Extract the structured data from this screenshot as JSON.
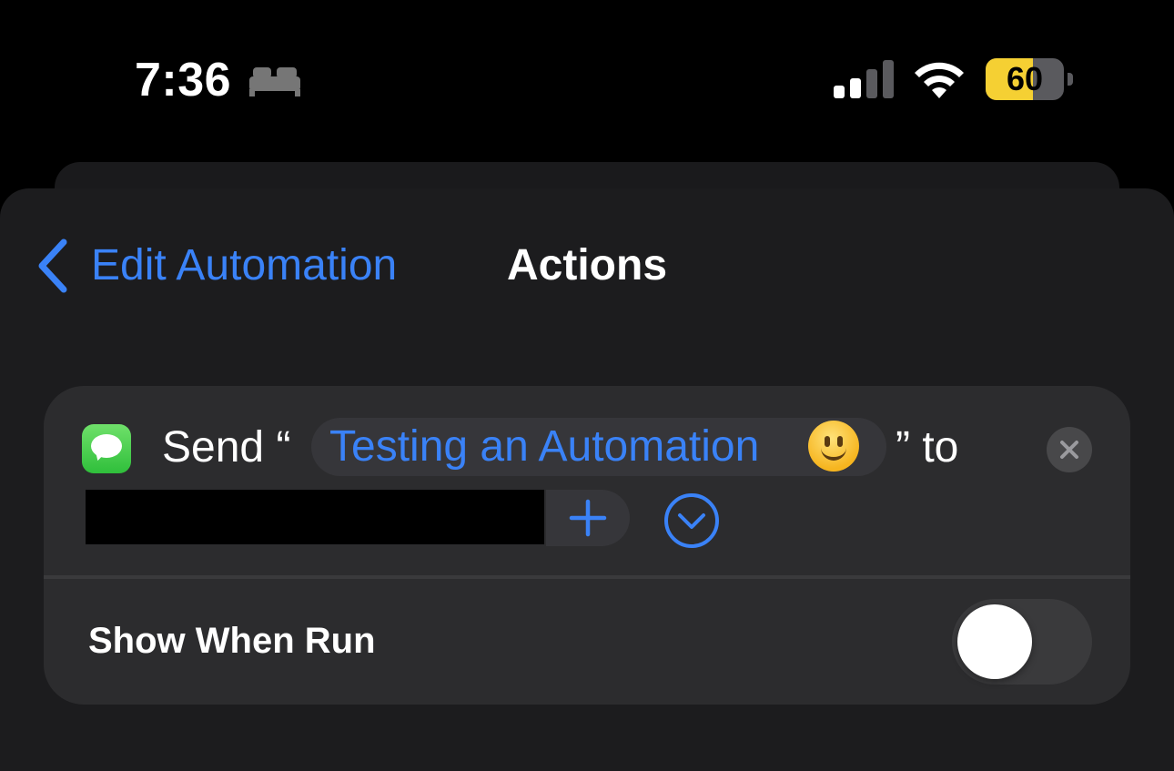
{
  "status_bar": {
    "time": "7:36",
    "focus_icon": "bed-icon",
    "battery_level": "60",
    "battery_fraction": 0.6,
    "battery_color": "#f5d033"
  },
  "nav": {
    "back_label": "Edit Automation",
    "title": "Actions"
  },
  "action": {
    "app_icon": "messages-icon",
    "prefix": "Send “",
    "message": "Testing an Automation",
    "message_emoji": "slightly-smiling-face-icon",
    "suffix": "” to",
    "recipient_redacted": true
  },
  "show_when_run": {
    "label": "Show When Run",
    "enabled": false
  },
  "colors": {
    "accent": "#3a82f7",
    "sheet": "#1c1c1e",
    "card": "#2c2c2e"
  }
}
